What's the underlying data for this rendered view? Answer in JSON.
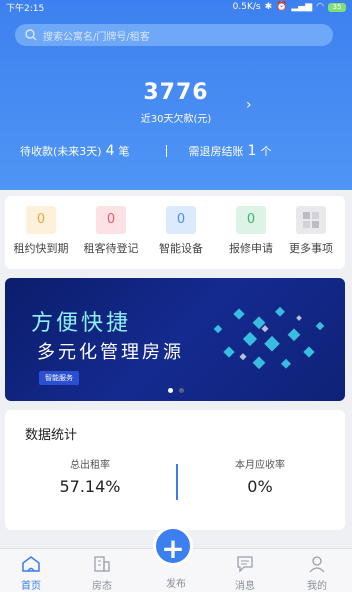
{
  "status_bar": {
    "time": "下午2:15",
    "speed": "0.5K/s",
    "battery": "35"
  },
  "search": {
    "placeholder": "搜索公寓名/门牌号/租客"
  },
  "overview": {
    "amount": "3776",
    "amount_label": "近30天欠款(元)",
    "pending_label": "待收款(未来3天)",
    "pending_count": "4",
    "pending_unit": "笔",
    "checkout_label": "需退房结账",
    "checkout_count": "1",
    "checkout_unit": "个"
  },
  "quick_actions": [
    {
      "label": "租约快到期",
      "count": "0",
      "color": "#f0a640",
      "bg": "#fdf1dc"
    },
    {
      "label": "租客待登记",
      "count": "0",
      "color": "#e85b6b",
      "bg": "#fde2e5"
    },
    {
      "label": "智能设备",
      "count": "0",
      "color": "#4a8ff0",
      "bg": "#dceafd"
    },
    {
      "label": "报修申请",
      "count": "0",
      "color": "#3fb56f",
      "bg": "#ddf3e5"
    },
    {
      "label": "更多事项",
      "icon": "grid-icon",
      "bg": "#e9e9ec"
    }
  ],
  "banner": {
    "title": "方便快捷",
    "subtitle": "多元化管理房源",
    "tag": "智能服务"
  },
  "stats": {
    "title": "数据统计",
    "rent_label": "总出租率",
    "rent_value": "57.14%",
    "due_label": "本月应收率",
    "due_value": "0%"
  },
  "tabs": [
    {
      "label": "首页",
      "icon": "home-icon",
      "active": true
    },
    {
      "label": "房态",
      "icon": "building-icon",
      "active": false
    },
    {
      "label": "发布",
      "icon": "plus-icon",
      "active": false
    },
    {
      "label": "消息",
      "icon": "message-icon",
      "active": false
    },
    {
      "label": "我的",
      "icon": "user-icon",
      "active": false
    }
  ],
  "colors": {
    "primary": "#3d80f0",
    "accent_line": "#3a7cf0"
  }
}
